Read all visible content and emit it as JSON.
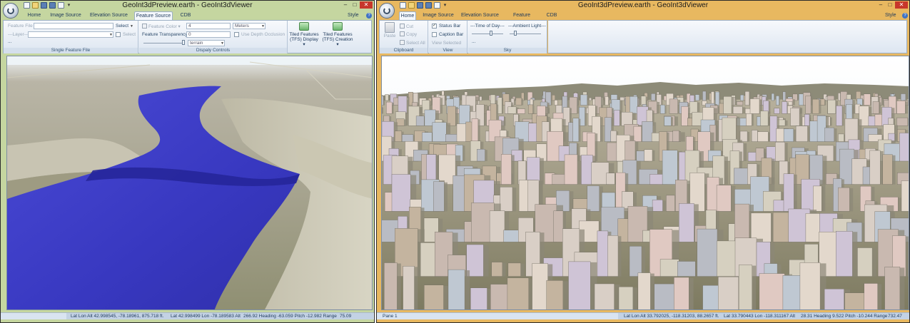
{
  "left_window": {
    "title": "GeoInt3dPreview.earth - GeoInt3dViewer",
    "tabs": [
      "Home",
      "Image Source",
      "Elevation Source",
      "Feature Source",
      "CDB"
    ],
    "active_tab": "Feature Source",
    "style_menu": "Style",
    "ribbon": {
      "single_feature_file": {
        "group_label": "Single Feature File",
        "feature_file_label": "Feature File",
        "feature_file_value": "",
        "select_label": "Select",
        "layer_label": "---Layer---",
        "layer_value": "",
        "select_checkbox_label": "Select",
        "ellipsis": "..."
      },
      "display_controls": {
        "group_label": "Dispaly Controls",
        "feature_color_label": "Feature Color",
        "feature_color_value": "4",
        "units_value": "Meters",
        "feature_transparency_label": "Feature Transparency",
        "transparency_value": "0",
        "use_depth_occlusion_label": "Use Depth Occlusion",
        "clamping_value": "terrain"
      },
      "tiled_display": {
        "line1": "Tiled Features",
        "line2": "(TFS) Display"
      },
      "tiled_creation": {
        "line1": "Tiled Features",
        "line2": "(TFS) Creation"
      }
    },
    "status": {
      "lat_lon_alt": "Lat Lon Alt 42.998545, -78.18961, 875.718 ft.",
      "lat_lon_alt2": "Lat 42.998499 Lon -78.189583 Alt",
      "heading": "266.92 Heading -63.059 Pitch -12.982 Range",
      "range": "75.09"
    }
  },
  "right_window": {
    "title": "GeoInt3dPreview.earth - GeoInt3dViewer",
    "tabs": [
      "Home",
      "Image Source",
      "Elevation Source",
      "Feature Source",
      "CDB"
    ],
    "active_tab": "Home",
    "style_menu": "Style",
    "ribbon": {
      "clipboard": {
        "group_label": "Clipboard",
        "paste": "Paste",
        "cut": "Cut",
        "copy": "Copy",
        "select_all": "Select All"
      },
      "view": {
        "group_label": "View",
        "status_bar": "Status Bar",
        "status_bar_checked": true,
        "caption_bar": "Caption Bar",
        "caption_bar_checked": false,
        "view_selected": "View Selected"
      },
      "sky": {
        "group_label": "Sky",
        "time_of_day": "---Time of Day---",
        "ambient_light": "---Ambient Light---",
        "ellipsis": "..."
      }
    },
    "status": {
      "pane": "Pane 1",
      "lat_lon_alt": "Lat Lon Alt 33.792025, -118.31203, 88.2657 ft.",
      "lat_lon_alt2": "Lat 33.790443 Lon -118.311167 Alt",
      "heading": "28.31 Heading 9.522 Pitch -10.244 Range",
      "range": "732.47"
    }
  },
  "colors": {
    "left_frame": "#c5d6a0",
    "right_frame": "#e8b860",
    "river": "#3c3cc8",
    "sky": "#eef4f7"
  },
  "icons": [
    "app-orb-icon",
    "new-icon",
    "open-icon",
    "save-icon",
    "save-all-icon",
    "close-file-icon",
    "tiled-features-icon",
    "paste-icon",
    "cut-icon",
    "copy-icon",
    "select-all-icon",
    "help-icon"
  ]
}
